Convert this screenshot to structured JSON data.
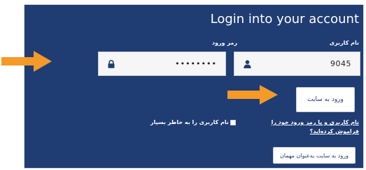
{
  "title": "Login into your account",
  "username": {
    "label": "نام کاربری",
    "value": "9045",
    "icon": "user-icon"
  },
  "password": {
    "label": "رمز ورود",
    "value": "••••••••",
    "icon": "lock-icon"
  },
  "login_button": "ورود به سایت",
  "forgot_link": "نام کاربری و یا رمز ورود خود را فراموش کرده‌اید؟",
  "remember_me": "نام کاربری را به خاطر بسپار",
  "guest_button": "ورود به سایت به‌عنوان مهمان",
  "colors": {
    "panel": "#1f3c73",
    "arrow": "#f39a28",
    "button_text": "#1f3c73"
  }
}
